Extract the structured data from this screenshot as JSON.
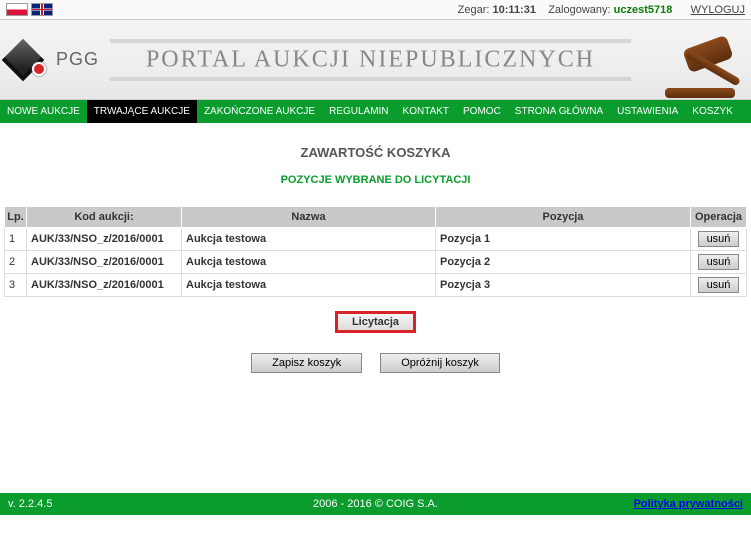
{
  "topbar": {
    "clock_label": "Zegar:",
    "clock_value": "10:11:31",
    "logged_label": "Zalogowany:",
    "user": "uczest5718",
    "logout": "WYLOGUJ"
  },
  "banner": {
    "logo_text": "PGG",
    "title": "PORTAL AUKCJI NIEPUBLICZNYCH"
  },
  "nav": {
    "items": [
      "NOWE AUKCJE",
      "TRWAJĄCE AUKCJE",
      "ZAKOŃCZONE AUKCJE",
      "REGULAMIN",
      "KONTAKT",
      "POMOC",
      "STRONA GŁÓWNA",
      "USTAWIENIA",
      "KOSZYK"
    ],
    "active_index": 1
  },
  "content": {
    "heading": "ZAWARTOŚĆ KOSZYKA",
    "subheading": "POZYCJE WYBRANE DO LICYTACJI",
    "columns": {
      "lp": "Lp.",
      "kod": "Kod aukcji:",
      "nazwa": "Nazwa",
      "pozycja": "Pozycja",
      "operacja": "Operacja"
    },
    "rows": [
      {
        "lp": "1",
        "kod": "AUK/33/NSO_z/2016/0001",
        "nazwa": "Aukcja testowa",
        "pozycja": "Pozycja 1"
      },
      {
        "lp": "2",
        "kod": "AUK/33/NSO_z/2016/0001",
        "nazwa": "Aukcja testowa",
        "pozycja": "Pozycja 2"
      },
      {
        "lp": "3",
        "kod": "AUK/33/NSO_z/2016/0001",
        "nazwa": "Aukcja testowa",
        "pozycja": "Pozycja 3"
      }
    ],
    "row_button": "usuń",
    "primary_button": "Licytacja",
    "save_button": "Zapisz koszyk",
    "clear_button": "Opróżnij koszyk"
  },
  "footer": {
    "version": "v. 2.2.4.5",
    "copy": "2006 - 2016 © COIG S.A.",
    "privacy": "Polityka prywatności"
  }
}
